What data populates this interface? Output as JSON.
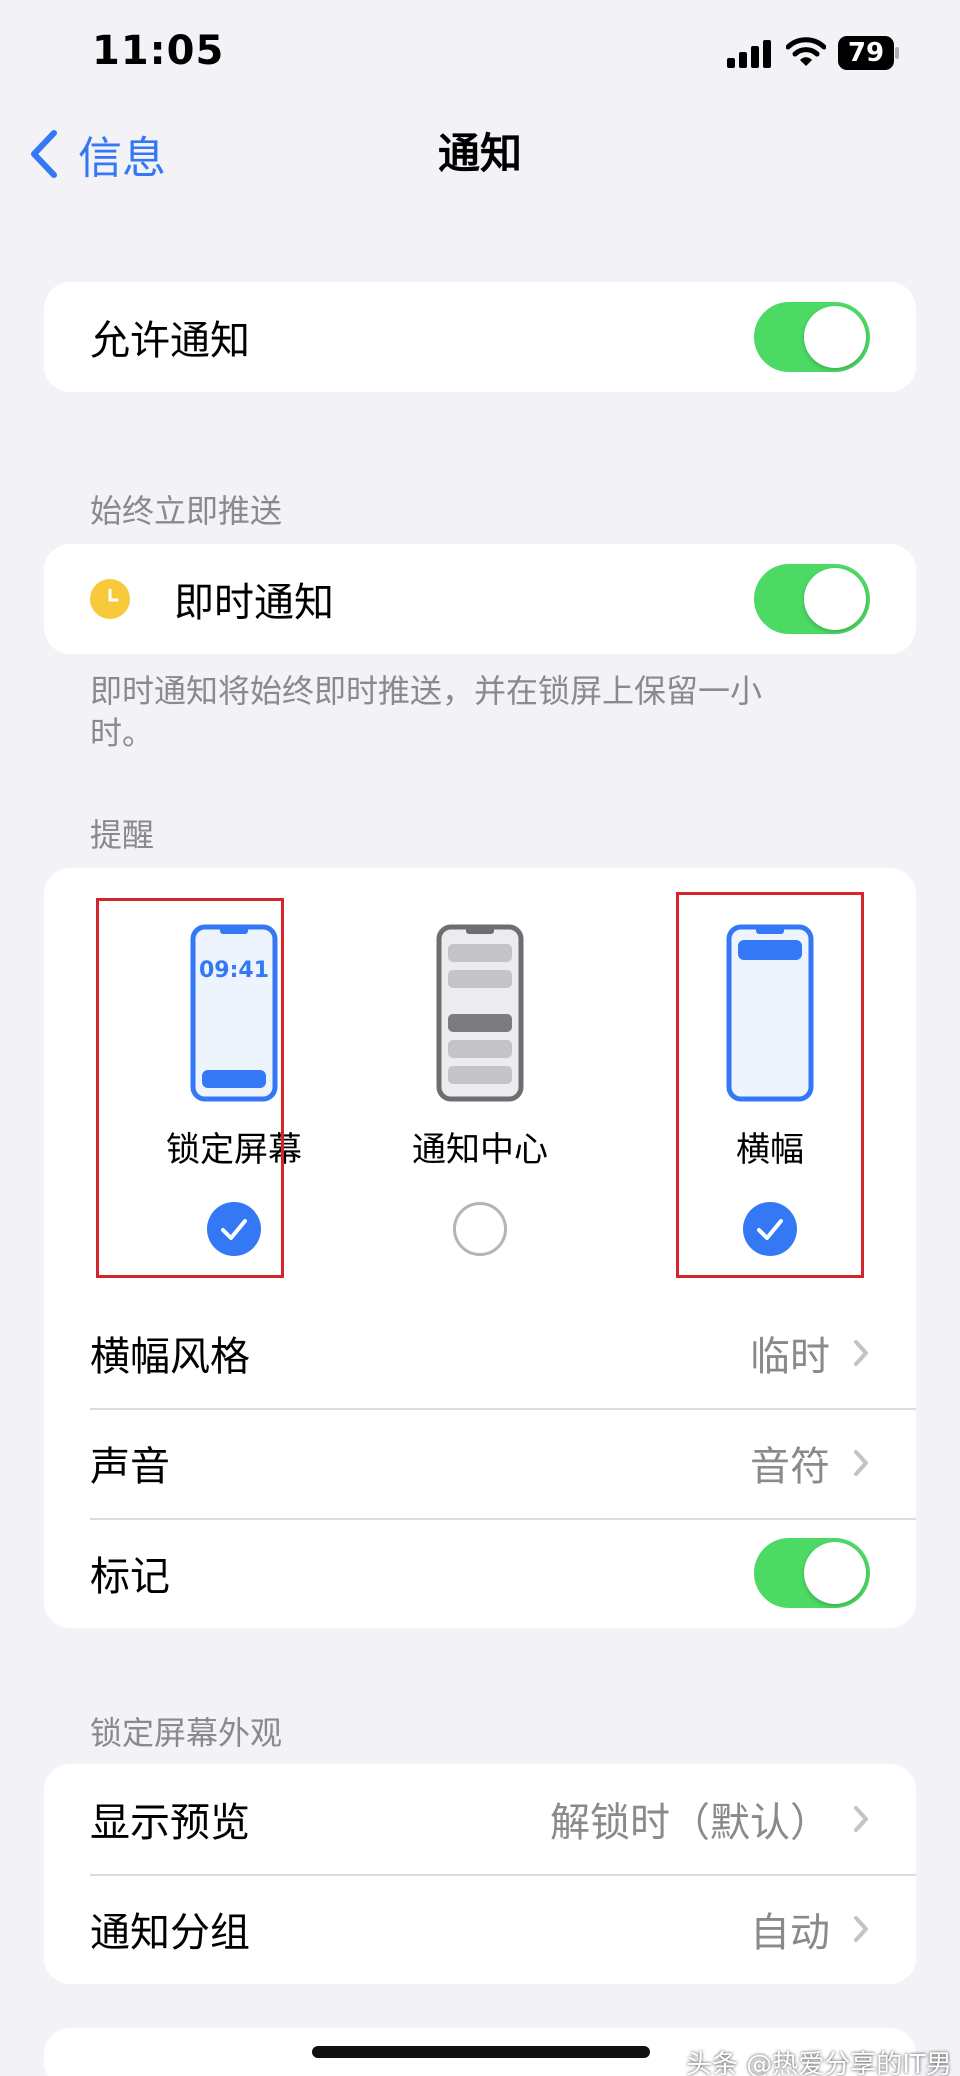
{
  "status_bar": {
    "time": "11:05",
    "battery": "79"
  },
  "nav": {
    "back_label": "信息",
    "title": "通知"
  },
  "allow": {
    "label": "允许通知",
    "enabled": true
  },
  "immediate": {
    "header": "始终立即推送",
    "label": "即时通知",
    "enabled": true,
    "note": "即时通知将始终即时推送，并在锁屏上保留一小时。",
    "icon": "clock-icon"
  },
  "alerts": {
    "header": "提醒",
    "options": [
      {
        "label": "锁定屏幕",
        "preview_time": "09:41",
        "selected": true,
        "icon": "lock-screen-phone-icon"
      },
      {
        "label": "通知中心",
        "selected": false,
        "icon": "notification-center-phone-icon"
      },
      {
        "label": "横幅",
        "selected": true,
        "icon": "banner-phone-icon"
      }
    ],
    "rows": [
      {
        "label": "横幅风格",
        "value": "临时"
      },
      {
        "label": "声音",
        "value": "音符"
      }
    ],
    "badges": {
      "label": "标记",
      "enabled": true
    }
  },
  "lock_screen": {
    "header": "锁定屏幕外观",
    "rows": [
      {
        "label": "显示预览",
        "value": "解锁时（默认）"
      },
      {
        "label": "通知分组",
        "value": "自动"
      }
    ]
  },
  "watermark": "头条 @热爱分享的IT男",
  "colors": {
    "accent": "#3478f6",
    "toggle_on": "#4cd964",
    "highlight_box": "#d9232b",
    "background": "#f2f2f7"
  }
}
